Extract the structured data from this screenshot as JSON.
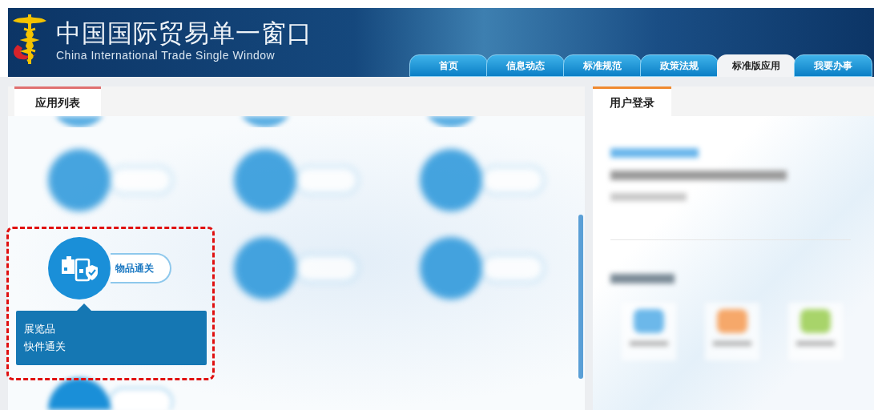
{
  "header": {
    "title": "中国国际贸易单一窗口",
    "subtitle": "China International Trade Single Window"
  },
  "nav_tabs": [
    {
      "label": "首页",
      "selected": false
    },
    {
      "label": "信息动态",
      "selected": false
    },
    {
      "label": "标准规范",
      "selected": false
    },
    {
      "label": "政策法规",
      "selected": false
    },
    {
      "label": "标准版应用",
      "selected": true
    },
    {
      "label": "我要办事",
      "selected": false
    }
  ],
  "app_panel": {
    "title": "应用列表",
    "apps": [
      {
        "label": "物品通关",
        "expanded": true,
        "submenu": [
          "展览品",
          "快件通关"
        ]
      }
    ]
  },
  "login_panel": {
    "title": "用户登录"
  }
}
